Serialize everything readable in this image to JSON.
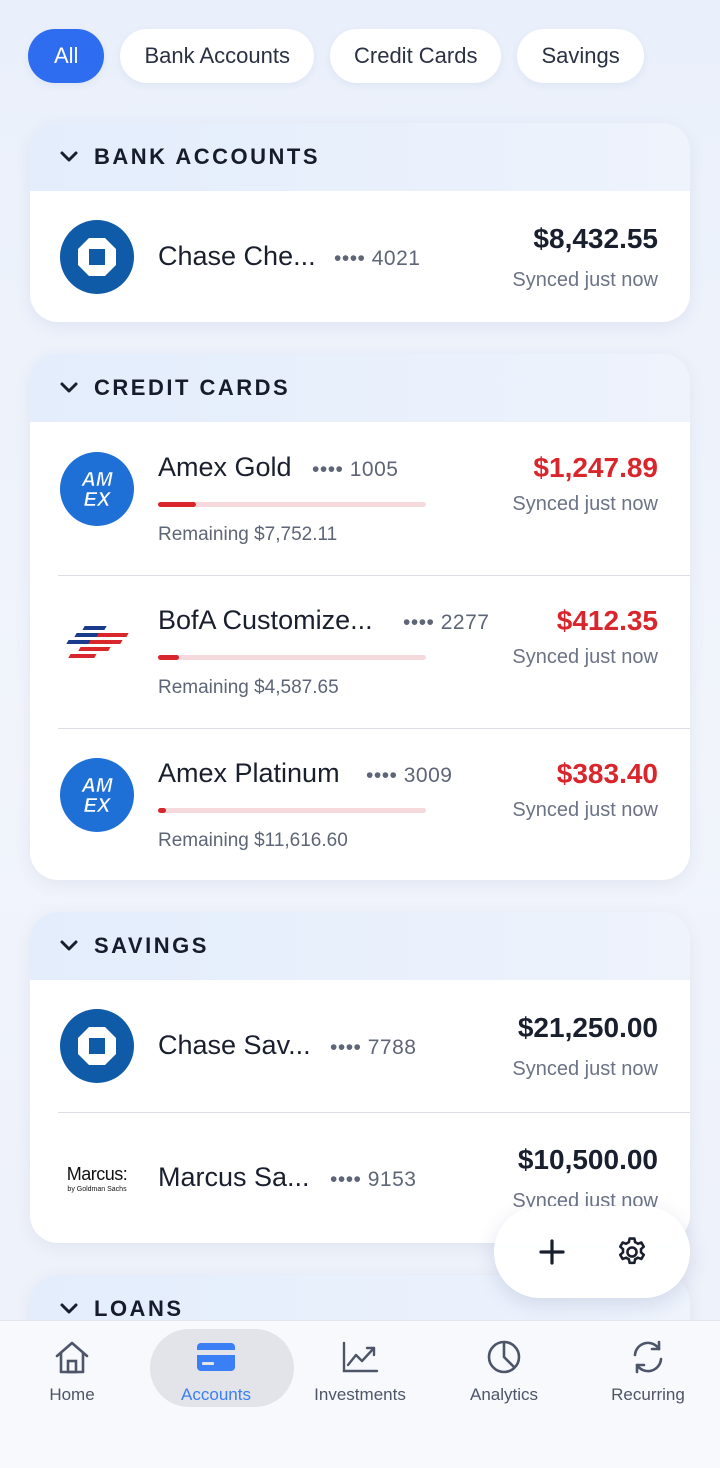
{
  "filters": {
    "all": "All",
    "bank": "Bank Accounts",
    "credit": "Credit Cards",
    "savings": "Savings"
  },
  "sections": {
    "bank": {
      "title": "BANK ACCOUNTS",
      "accounts": [
        {
          "name": "Chase Che...",
          "mask": "•••• 4021",
          "amount": "$8,432.55",
          "synced": "Synced just now",
          "logo": "chase-logo"
        }
      ]
    },
    "credit": {
      "title": "CREDIT CARDS",
      "accounts": [
        {
          "name": "Amex Gold",
          "mask": "•••• 1005",
          "amount": "$1,247.89",
          "synced": "Synced just now",
          "remaining": "Remaining $7,752.11",
          "utilization": 0.14,
          "logo": "amex-logo"
        },
        {
          "name": "BofA Customize...",
          "mask": "•••• 2277",
          "amount": "$412.35",
          "synced": "Synced just now",
          "remaining": "Remaining $4,587.65",
          "utilization": 0.08,
          "logo": "bofa-logo"
        },
        {
          "name": "Amex Platinum",
          "mask": "•••• 3009",
          "amount": "$383.40",
          "synced": "Synced just now",
          "remaining": "Remaining $11,616.60",
          "utilization": 0.03,
          "logo": "amex-logo"
        }
      ]
    },
    "savings": {
      "title": "SAVINGS",
      "accounts": [
        {
          "name": "Chase Sav...",
          "mask": "•••• 7788",
          "amount": "$21,250.00",
          "synced": "Synced just now",
          "logo": "chase-logo"
        },
        {
          "name": "Marcus Sa...",
          "mask": "•••• 9153",
          "amount": "$10,500.00",
          "synced": "Synced just now",
          "logo": "marcus-logo",
          "logo_text": "Marcus:",
          "logo_subtext": "by Goldman Sachs"
        }
      ]
    },
    "loans": {
      "title": "LOANS"
    }
  },
  "nav": {
    "home": "Home",
    "accounts": "Accounts",
    "investments": "Investments",
    "analytics": "Analytics",
    "recurring": "Recurring"
  },
  "colors": {
    "accent": "#2f6df0",
    "negative": "#d9262d",
    "chase": "#0f5ba7",
    "amex": "#1e6fd6",
    "nav_active": "#3a7ff5"
  }
}
